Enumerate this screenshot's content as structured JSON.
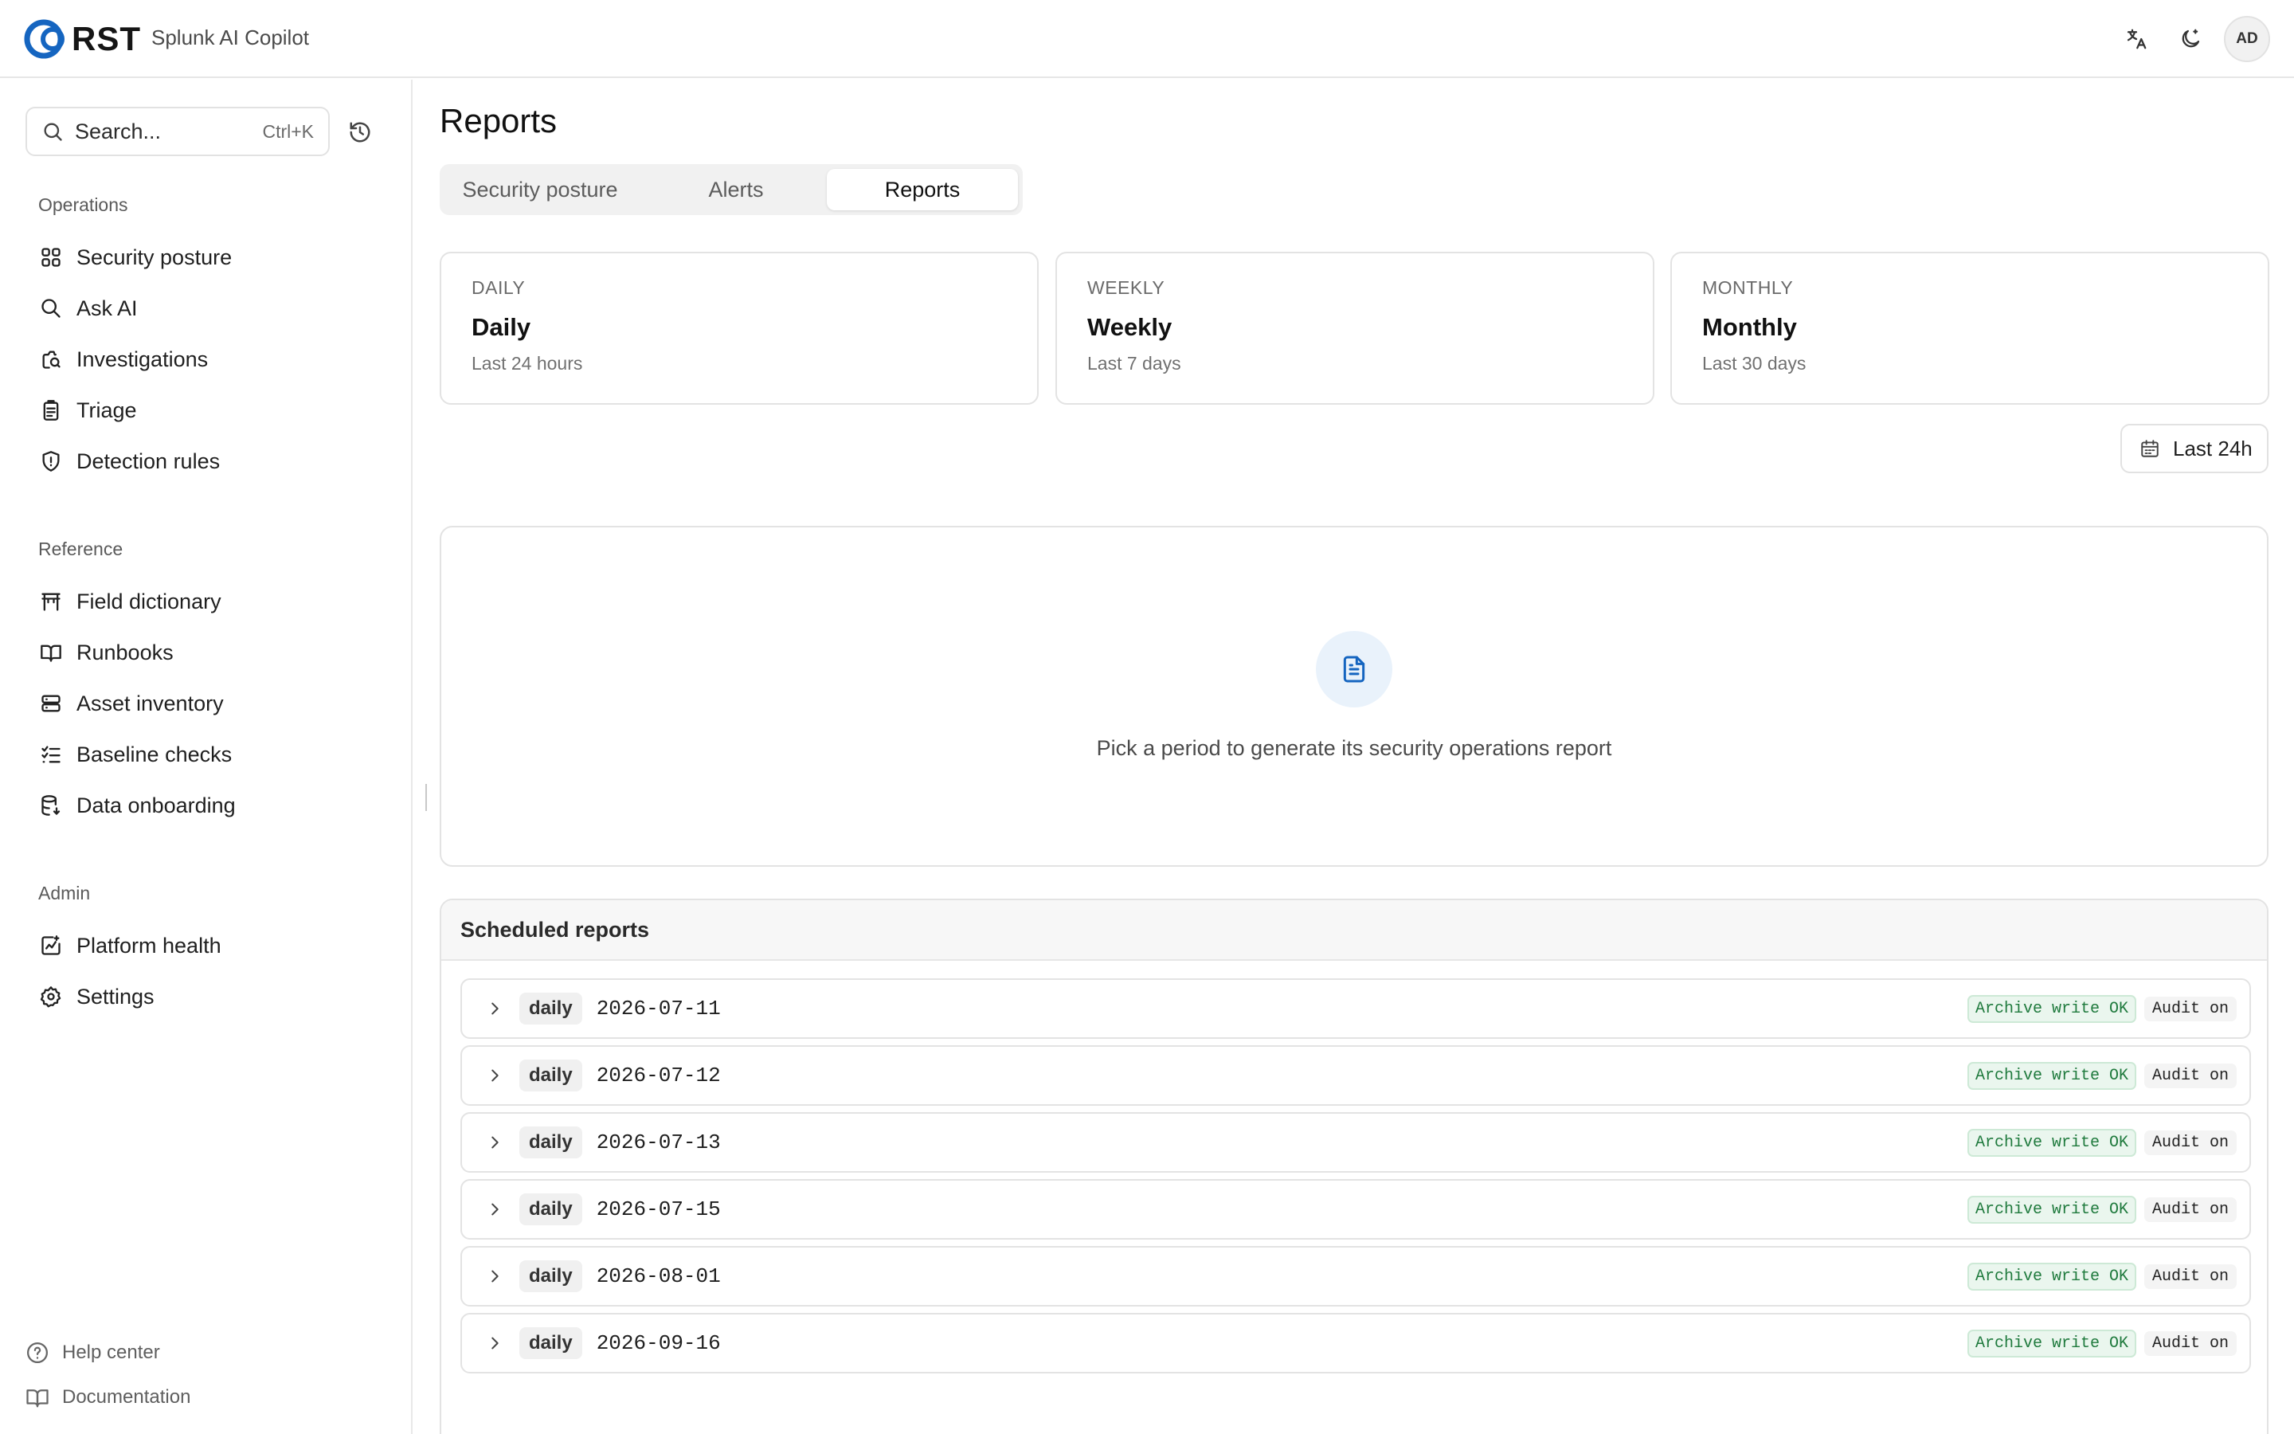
{
  "app": {
    "logo_text": "RST",
    "name": "Splunk AI Copilot",
    "avatar_initials": "AD",
    "brand_color": "#1565c0"
  },
  "topbar_icons": [
    "translate-icon",
    "theme-moon-icon"
  ],
  "sidebar": {
    "search": {
      "placeholder": "Search...",
      "shortcut": "Ctrl+K"
    },
    "sections": [
      {
        "label": "Operations",
        "items": [
          {
            "label": "Security posture",
            "icon": "grid-icon"
          },
          {
            "label": "Ask AI",
            "icon": "search-icon"
          },
          {
            "label": "Investigations",
            "icon": "investigation-icon"
          },
          {
            "label": "Triage",
            "icon": "clipboard-icon"
          },
          {
            "label": "Detection rules",
            "icon": "shield-alert-icon"
          }
        ]
      },
      {
        "label": "Reference",
        "items": [
          {
            "label": "Field dictionary",
            "icon": "table-icon"
          },
          {
            "label": "Runbooks",
            "icon": "book-open-icon"
          },
          {
            "label": "Asset inventory",
            "icon": "server-icon"
          },
          {
            "label": "Baseline checks",
            "icon": "checklist-icon"
          },
          {
            "label": "Data onboarding",
            "icon": "database-import-icon"
          }
        ]
      },
      {
        "label": "Admin",
        "items": [
          {
            "label": "Platform health",
            "icon": "health-chart-icon"
          },
          {
            "label": "Settings",
            "icon": "gear-icon"
          }
        ]
      }
    ],
    "footer": [
      {
        "label": "Help center",
        "icon": "help-circle-icon"
      },
      {
        "label": "Documentation",
        "icon": "book-icon"
      }
    ]
  },
  "main": {
    "title": "Reports",
    "tabs": [
      {
        "label": "Security posture",
        "active": false
      },
      {
        "label": "Alerts",
        "active": false
      },
      {
        "label": "Reports",
        "active": true
      }
    ],
    "periods": [
      {
        "caption": "DAILY",
        "title": "Daily",
        "subtitle": "Last 24 hours"
      },
      {
        "caption": "WEEKLY",
        "title": "Weekly",
        "subtitle": "Last 7 days"
      },
      {
        "caption": "MONTHLY",
        "title": "Monthly",
        "subtitle": "Last 30 days"
      }
    ],
    "range_button": "Last 24h",
    "empty_state": "Pick a period to generate its security operations report",
    "scheduled": {
      "title": "Scheduled reports",
      "rows": [
        {
          "type": "daily",
          "date": "2026-07-11",
          "status": "Archive write OK",
          "audit": "Audit on"
        },
        {
          "type": "daily",
          "date": "2026-07-12",
          "status": "Archive write OK",
          "audit": "Audit on"
        },
        {
          "type": "daily",
          "date": "2026-07-13",
          "status": "Archive write OK",
          "audit": "Audit on"
        },
        {
          "type": "daily",
          "date": "2026-07-15",
          "status": "Archive write OK",
          "audit": "Audit on"
        },
        {
          "type": "daily",
          "date": "2026-08-01",
          "status": "Archive write OK",
          "audit": "Audit on"
        },
        {
          "type": "daily",
          "date": "2026-09-16",
          "status": "Archive write OK",
          "audit": "Audit on"
        }
      ]
    }
  }
}
